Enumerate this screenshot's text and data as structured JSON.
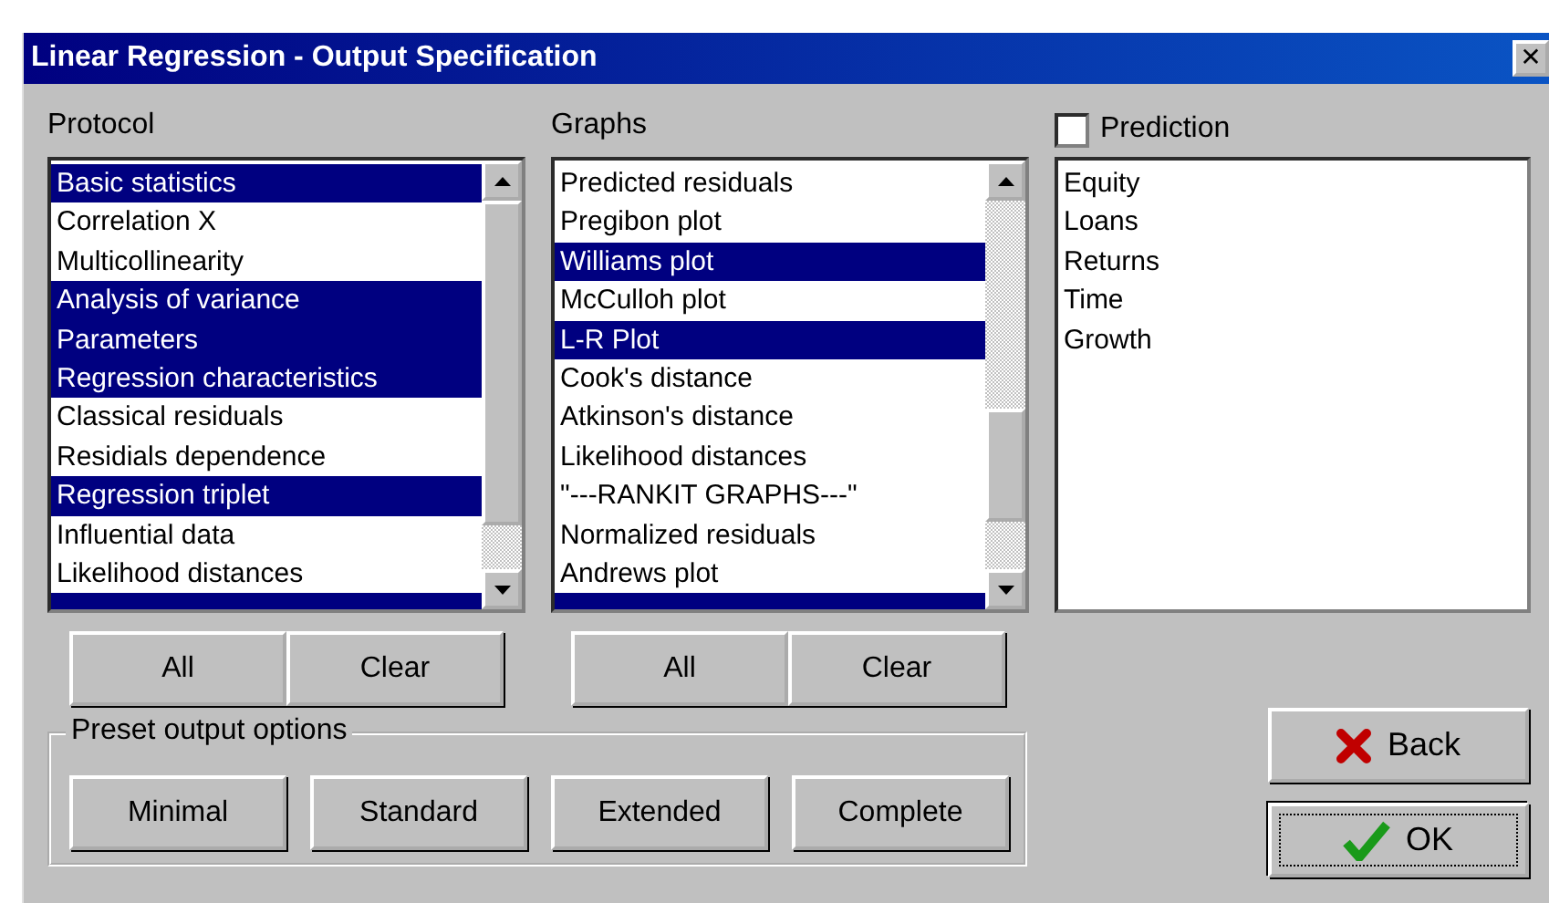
{
  "window": {
    "title": "Linear Regression - Output Specification",
    "close": "✕"
  },
  "protocol": {
    "label": "Protocol",
    "items": [
      {
        "label": "Basic statistics",
        "selected": true
      },
      {
        "label": "Correlation X",
        "selected": false
      },
      {
        "label": "Multicollinearity",
        "selected": false
      },
      {
        "label": "Analysis of variance",
        "selected": true
      },
      {
        "label": "Parameters",
        "selected": true
      },
      {
        "label": "Regression characteristics",
        "selected": true
      },
      {
        "label": "Classical residuals",
        "selected": false
      },
      {
        "label": "Residials dependence",
        "selected": false
      },
      {
        "label": "Regression triplet",
        "selected": true
      },
      {
        "label": "Influential data",
        "selected": false
      },
      {
        "label": "Likelihood distances",
        "selected": false
      },
      {
        "selected": true
      }
    ],
    "buttons": [
      "All",
      "Clear"
    ]
  },
  "graphs": {
    "label": "Graphs",
    "items": [
      {
        "label": "Predicted residuals",
        "selected": false
      },
      {
        "label": "Pregibon plot",
        "selected": false
      },
      {
        "label": "Williams plot",
        "selected": true
      },
      {
        "label": "McCulloh plot",
        "selected": false
      },
      {
        "label": "L-R Plot",
        "selected": true
      },
      {
        "label": "Cook's distance",
        "selected": false
      },
      {
        "label": "Atkinson's distance",
        "selected": false
      },
      {
        "label": "Likelihood distances",
        "selected": false
      },
      {
        "label": "\"---RANKIT GRAPHS---\"",
        "selected": false
      },
      {
        "label": "Normalized residuals",
        "selected": false
      },
      {
        "label": "Andrews plot",
        "selected": false
      },
      {
        "selected": true
      }
    ],
    "buttons": [
      "All",
      "Clear"
    ]
  },
  "prediction": {
    "label": "Prediction",
    "checked": false,
    "items": [
      "Equity",
      "Loans",
      "Returns",
      "Time",
      "Growth"
    ]
  },
  "preset": {
    "label": "Preset output options",
    "buttons": [
      "Minimal",
      "Standard",
      "Extended",
      "Complete"
    ]
  },
  "actions": [
    {
      "label": "Back",
      "kind": "back"
    },
    {
      "label": "OK",
      "kind": "ok"
    }
  ]
}
